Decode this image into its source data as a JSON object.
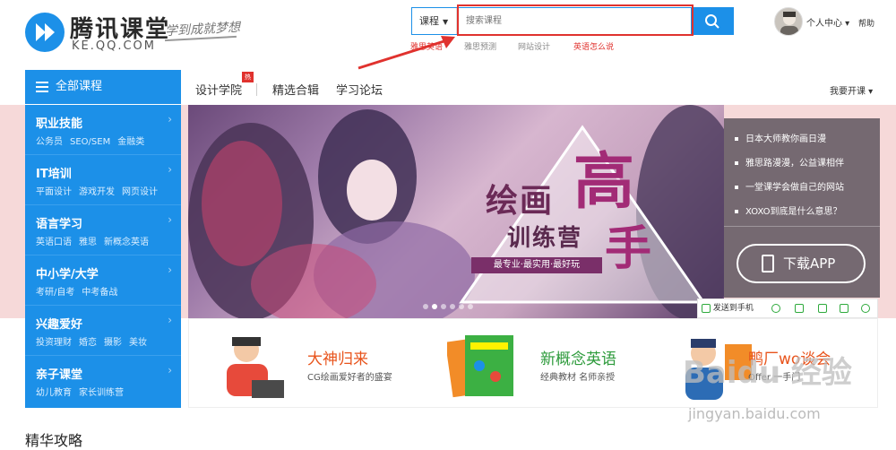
{
  "logo": {
    "title": "腾讯课堂",
    "subtitle": "KE.QQ.COM",
    "slogan": "学到成就梦想"
  },
  "search": {
    "category": "课程",
    "placeholder": "搜索课程"
  },
  "hot_words": [
    "雅思英语",
    "雅思预测",
    "网站设计",
    "英语怎么说"
  ],
  "user": {
    "center_label": "个人中心",
    "help_label": "帮助"
  },
  "nav": {
    "all_courses": "全部课程",
    "items": [
      "设计学院",
      "精选合辑",
      "学习论坛"
    ],
    "hot_badge": "热",
    "open_course": "我要开课"
  },
  "categories": [
    {
      "title": "职业技能",
      "subs": [
        "公务员",
        "SEO/SEM",
        "金融类"
      ]
    },
    {
      "title": "IT培训",
      "subs": [
        "平面设计",
        "游戏开发",
        "网页设计"
      ]
    },
    {
      "title": "语言学习",
      "subs": [
        "英语口语",
        "雅思",
        "新概念英语"
      ]
    },
    {
      "title": "中小学/大学",
      "subs": [
        "考研/自考",
        "中考备战"
      ]
    },
    {
      "title": "兴趣爱好",
      "subs": [
        "投资理财",
        "婚恋",
        "摄影",
        "美妆"
      ]
    },
    {
      "title": "亲子课堂",
      "subs": [
        "幼儿教育",
        "家长训练营"
      ]
    }
  ],
  "banner": {
    "line1": "绘画",
    "big1": "高",
    "big2": "手",
    "line2": "训练营",
    "tagline": "最专业·最实用·最好玩"
  },
  "news": [
    "日本大师教你画日漫",
    "雅思路漫漫，公益课相伴",
    "一堂课学会做自己的网站",
    "XOXO到底是什么意思？"
  ],
  "download": "下载APP",
  "share": {
    "send_to_phone": "发送到手机"
  },
  "promos": [
    {
      "title": "大神归来",
      "desc": "CG绘画爱好者的盛宴"
    },
    {
      "title": "新概念英语",
      "desc": "经典教材 名师亲授"
    },
    {
      "title": "鸭厂wo谈会",
      "desc": "Offer 一手门"
    }
  ],
  "section": {
    "title": "精华攻略"
  },
  "watermark": {
    "text": "Baidu 经验",
    "url": "jingyan.baidu.com"
  },
  "colors": {
    "brand_blue": "#1c90e8",
    "highlight_red": "#e0322e",
    "band_pink": "#f6d9d9"
  }
}
